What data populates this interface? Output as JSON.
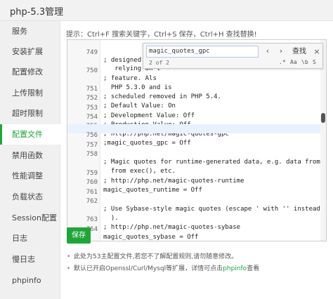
{
  "window": {
    "title": "php-5.3管理"
  },
  "sidebar": {
    "items": [
      {
        "label": "服务",
        "active": false
      },
      {
        "label": "安装扩展",
        "active": false
      },
      {
        "label": "配置修改",
        "active": false
      },
      {
        "label": "上传限制",
        "active": false
      },
      {
        "label": "超时限制",
        "active": false
      },
      {
        "label": "配置文件",
        "active": true
      },
      {
        "label": "禁用函数",
        "active": false
      },
      {
        "label": "性能调整",
        "active": false
      },
      {
        "label": "负载状态",
        "active": false
      },
      {
        "label": "Session配置",
        "active": false
      },
      {
        "label": "日志",
        "active": false
      },
      {
        "label": "慢日志",
        "active": false
      },
      {
        "label": "phpinfo",
        "active": false
      }
    ]
  },
  "hint": "提示：Ctrl+F 搜索关键字，Ctrl+S 保存，Ctrl+H 查找替换!",
  "editor": {
    "lines": [
      {
        "num": "749",
        "code": "; designed spe"
      },
      {
        "num": "",
        "code": "   relying on t"
      },
      {
        "num": "750",
        "code": "; feature. Als"
      },
      {
        "num": "",
        "code": "  PHP 5.3.0 and is"
      },
      {
        "num": "751",
        "code": "; scheduled removed in PHP 5.4."
      },
      {
        "num": "752",
        "code": "; Default Value: On"
      },
      {
        "num": "753",
        "code": "; Development Value: Off"
      },
      {
        "num": "754",
        "code": "; Production Value: Off"
      },
      {
        "num": "755",
        "code": "; http://php.net/magic-quotes-gpc"
      },
      {
        "num": "756",
        "code": ";magic_quotes_gpc = Off",
        "active": true
      },
      {
        "num": "757",
        "code": ""
      },
      {
        "num": "758",
        "code": "; Magic quotes for runtime-generated data, e.g. data from SQL,"
      },
      {
        "num": "",
        "code": "  from exec(), etc."
      },
      {
        "num": "759",
        "code": "; http://php.net/magic-quotes-runtime"
      },
      {
        "num": "760",
        "code": "magic_quotes_runtime = Off"
      },
      {
        "num": "761",
        "code": ""
      },
      {
        "num": "762",
        "code": "; Use Sybase-style magic quotes (escape ' with '' instead of \\'"
      },
      {
        "num": "",
        "code": "  )."
      },
      {
        "num": "763",
        "code": "; http://php.net/magic-quotes-sybase"
      },
      {
        "num": "764",
        "code": "magic_quotes_sybase = Off"
      }
    ]
  },
  "search": {
    "value": "magic_quotes_gpc",
    "match_count": "2 of 2",
    "prev_icon": "‹",
    "next_icon": "›",
    "find_label": "查找",
    "close_icon": "×",
    "opt_regex": ".*",
    "opt_case": "Aa",
    "opt_word": "\\b",
    "opt_selection": "S"
  },
  "save_label": "保存",
  "notes": [
    {
      "text": "此处为53主配置文件,若您不了解配置规则,请勿随意修改。",
      "link": "",
      "suffix": ""
    },
    {
      "text": "默认已开启Openssl/Curl/Mysql等扩展，详情可点击",
      "link": "phpinfo",
      "suffix": "查看"
    }
  ],
  "colors": {
    "accent": "#20a53a",
    "active_line": "#e8f2ff"
  }
}
